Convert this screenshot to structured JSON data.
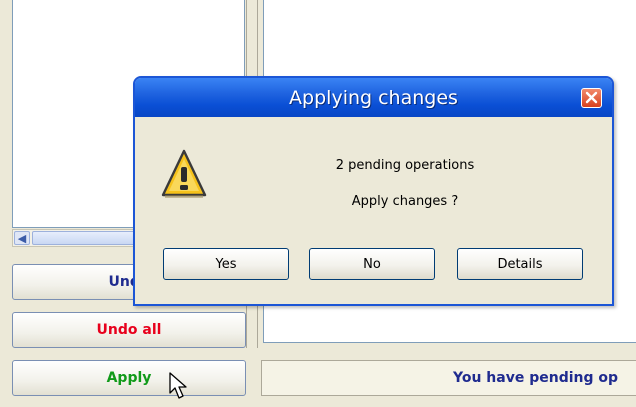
{
  "dialog": {
    "title": "Applying changes",
    "message_line1": "2 pending operations",
    "message_line2": "Apply changes ?",
    "buttons": {
      "yes": "Yes",
      "no": "No",
      "details": "Details"
    }
  },
  "left_panel": {
    "undo_label": "Undo",
    "undo_all_label": "Undo all",
    "apply_label": "Apply"
  },
  "status": {
    "text": "You have pending op"
  },
  "colors": {
    "undo_text": "#1f2b8f",
    "undo_all_text": "#e8001c",
    "apply_text": "#119a1a",
    "title_bar": "#0a4fd5",
    "status_text": "#1f2b8f"
  },
  "icons": {
    "dialog": "warning-icon",
    "close": "close-icon",
    "cursor": "mouse-pointer-icon"
  }
}
